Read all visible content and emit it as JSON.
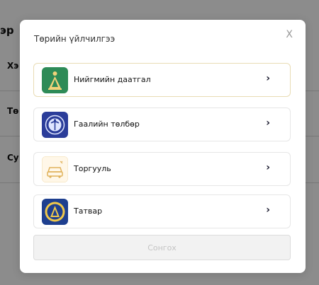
{
  "background": {
    "heading": "эр",
    "rows": [
      {
        "label": "Хэ"
      },
      {
        "label": "Тө"
      },
      {
        "label": "Су"
      }
    ]
  },
  "modal": {
    "title": "Төрийн үйлчилгээ",
    "close_label": "X",
    "items": [
      {
        "label": "Нийгмийн даатгал",
        "icon": "social-insurance-icon",
        "chevron": "›"
      },
      {
        "label": "Гаалийн төлбөр",
        "icon": "customs-emblem-icon",
        "chevron": "›"
      },
      {
        "label": "Торгууль",
        "icon": "fine-car-icon",
        "chevron": "›"
      },
      {
        "label": "Татвар",
        "icon": "tax-emblem-icon",
        "chevron": "›"
      }
    ],
    "select_button": "Сонгох"
  },
  "colors": {
    "insurance_green": "#2e8b57",
    "customs_blue": "#2b3d9a",
    "tax_blue": "#1e3f8f",
    "active_border": "#e9dcb4"
  }
}
